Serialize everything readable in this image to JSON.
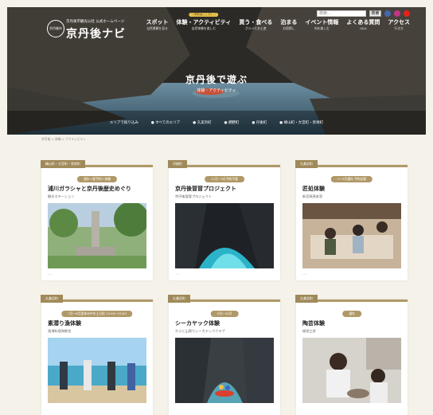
{
  "header": {
    "logo_seal": "京丹後市",
    "logo_sub": "京丹後市観光公社 公式ホームページ",
    "logo_name": "京丹後ナビ",
    "search_placeholder": "検索…",
    "search_button": "検索",
    "social": [
      {
        "icon": "facebook-icon",
        "color": "#4267b2"
      },
      {
        "icon": "instagram-icon",
        "color": "#c13584"
      },
      {
        "icon": "youtube-icon",
        "color": "#e62117"
      }
    ],
    "nav": [
      {
        "label": "スポット",
        "en": "自然景観を見る"
      },
      {
        "label": "体験・アクティビティ",
        "en": "自然体験を楽しむ",
        "badge": "＼予約はここで！／"
      },
      {
        "label": "買う・食べる",
        "en": "グルメとお土産"
      },
      {
        "label": "泊まる",
        "en": "お宿探し"
      },
      {
        "label": "イベント情報",
        "en": "旬を楽しむ"
      },
      {
        "label": "よくある質問",
        "en": "Q&A"
      },
      {
        "label": "アクセス",
        "en": "行き方"
      }
    ]
  },
  "hero": {
    "title": "京丹後で遊ぶ",
    "subtitle": "体験・アクティビティ"
  },
  "subnav": [
    "エリアで絞り込み",
    "すべてのエリア",
    "久美浜町",
    "網野町",
    "丹後町",
    "峰山町・大宮町・弥栄町"
  ],
  "breadcrumb": "京丹後 > 体験 > アクティビティ",
  "cards": [
    {
      "category": "峰山町・大宮町・弥栄町",
      "pill": "通年＜要予約＞体験",
      "title": "浦川ガラシャと京丹後歴史めぐり",
      "org": "観光ステーション",
      "more": "…",
      "photo": "monument"
    },
    {
      "category": "丹後町",
      "pill": "11月〜3月予約不要",
      "title": "京丹後冒冒プロジェクト",
      "org": "京丹後冒冒プロジェクト",
      "more": "…",
      "photo": "cave"
    },
    {
      "category": "久美浜町",
      "pill": "1〜3月通年 予約必要",
      "title": "匠処体験",
      "org": "新宮焼窯本家",
      "more": "…",
      "photo": "workshop"
    },
    {
      "category": "久美浜町",
      "pill": "7月〜8月夏休み中の土日祝 10:00〜15:00",
      "title": "素潜り漁体験",
      "org": "漁港料理海鮮舎",
      "more": "",
      "photo": "beach"
    },
    {
      "category": "久美浜町",
      "pill": "5月〜10月",
      "title": "シーカヤック体験",
      "org": "かぶと山周りシーカヤッククラブ",
      "more": "",
      "photo": "kayak"
    },
    {
      "category": "久美浜町",
      "pill": "通年",
      "title": "陶芸体験",
      "org": "縁窯工房",
      "more": "",
      "photo": "pottery"
    }
  ]
}
